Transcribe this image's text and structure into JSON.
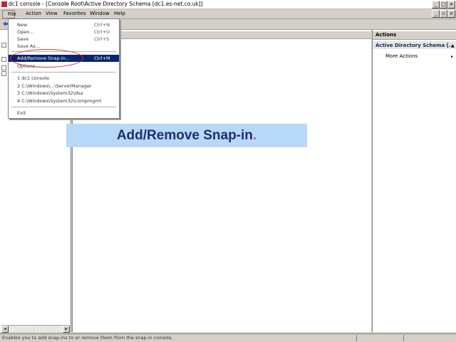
{
  "window": {
    "title": "dc1 console - [Console Root\\Active Directory Schema [dc1.es-net.co.uk]]"
  },
  "menubar": {
    "items": [
      "File",
      "Action",
      "View",
      "Favorites",
      "Window",
      "Help"
    ]
  },
  "file_menu": {
    "items": [
      {
        "label": "New",
        "shortcut": "Ctrl+N"
      },
      {
        "label": "Open...",
        "shortcut": "Ctrl+O"
      },
      {
        "label": "Save",
        "shortcut": "Ctrl+S"
      },
      {
        "label": "Save As...",
        "shortcut": ""
      },
      {
        "label": "Add/Remove Snap-in...",
        "shortcut": "Ctrl+M"
      },
      {
        "label": "Options...",
        "shortcut": ""
      }
    ],
    "recent": [
      "1 dc1 console",
      "2 C:\\Windows\\...\\ServerManager",
      "3 C:\\Windows\\System32\\dsa",
      "4 C:\\Windows\\System32\\compmgmt"
    ],
    "exit_label": "Exit"
  },
  "actions": {
    "header": "Actions",
    "section": "Active Directory Schema [...",
    "item": "More Actions"
  },
  "status": {
    "text": "Enables you to add snap-ins to or remove them from the snap-in console."
  },
  "caption": {
    "text": "Add/Remove Snap-in",
    "dot": "."
  },
  "colors": {
    "caption_bg": "#b8d8f8",
    "caption_text": "#1f2e6e",
    "highlight": "#0a246a",
    "annotation": "#e0303a"
  }
}
